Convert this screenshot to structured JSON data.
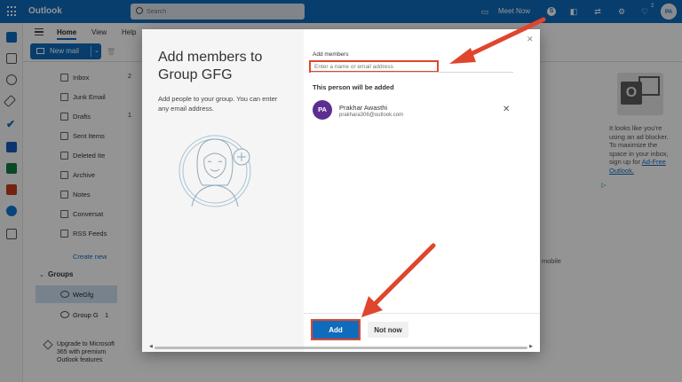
{
  "topbar": {
    "app_name": "Outlook",
    "search_placeholder": "Search",
    "meet_now": "Meet Now",
    "notification_count": "2",
    "avatar_initials": "PA"
  },
  "ribbon": {
    "tabs": [
      "Home",
      "View",
      "Help"
    ],
    "new_mail": "New mail"
  },
  "folders": [
    {
      "label": "Inbox",
      "count": "2"
    },
    {
      "label": "Junk Email",
      "count": ""
    },
    {
      "label": "Drafts",
      "count": "1"
    },
    {
      "label": "Sent Items",
      "count": ""
    },
    {
      "label": "Deleted Ite",
      "count": ""
    },
    {
      "label": "Archive",
      "count": ""
    },
    {
      "label": "Notes",
      "count": ""
    },
    {
      "label": "Conversat",
      "count": ""
    },
    {
      "label": "RSS Feeds",
      "count": ""
    }
  ],
  "create_new": "Create new",
  "groups": {
    "header": "Groups",
    "items": [
      {
        "label": "WeGfg",
        "count": ""
      },
      {
        "label": "Group G",
        "count": "1"
      }
    ]
  },
  "upgrade_text": "Upgrade to Microsoft 365 with premium Outlook features",
  "ad": {
    "text": "It looks like you're using an ad blocker. To maximize the space in your inbox, sign up for",
    "link": "Ad-Free Outlook."
  },
  "background_text": {
    "mobile": "k mobile"
  },
  "dialog": {
    "title": "Add members to Group GFG",
    "description": "Add people to your group. You can enter any email address.",
    "add_members_label": "Add members",
    "input_placeholder": "Enter a name or email address",
    "will_be_added": "This person will be added",
    "person": {
      "initials": "PA",
      "name": "Prakhar Awasthi",
      "email": "prakhara306@outlook.com"
    },
    "add_button": "Add",
    "not_now_button": "Not now"
  },
  "colors": {
    "brand_blue": "#0f6cbd",
    "annotation_red": "#e0452d",
    "person_avatar": "#5c2e91"
  }
}
